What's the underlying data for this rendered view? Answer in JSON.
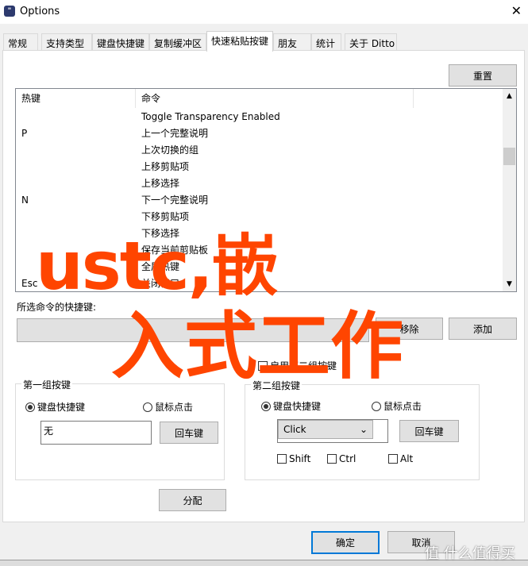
{
  "window": {
    "title": "Options",
    "icon": "ditto-app-icon",
    "close": "✕"
  },
  "tabs": [
    "常规",
    "支持类型",
    "键盘快捷键",
    "复制缓冲区",
    "快速粘贴按键",
    "朋友",
    "统计",
    "关于 Ditto"
  ],
  "reset_label": "重置",
  "list": {
    "headers": [
      "热键",
      "命令"
    ],
    "rows": [
      {
        "key": "",
        "cmd": "Toggle Transparency Enabled"
      },
      {
        "key": "P",
        "cmd": "上一个完整说明"
      },
      {
        "key": "",
        "cmd": "上次切换的组"
      },
      {
        "key": "",
        "cmd": "上移剪贴项"
      },
      {
        "key": "",
        "cmd": "上移选择"
      },
      {
        "key": "N",
        "cmd": "下一个完整说明"
      },
      {
        "key": "",
        "cmd": "下移剪贴项"
      },
      {
        "key": "",
        "cmd": "下移选择"
      },
      {
        "key": "",
        "cmd": "保存当前剪贴板"
      },
      {
        "key": "",
        "cmd": "全屏热键"
      },
      {
        "key": "Esc",
        "cmd": "关闭窗口"
      }
    ]
  },
  "selected_label": "所选命令的快捷键:",
  "remove_label": "移除",
  "add_label": "添加",
  "enable_second": "启用第二组按键",
  "group1": {
    "title": "第一组按键",
    "radio_keyboard": "键盘快捷键",
    "radio_mouse": "鼠标点击",
    "value": "无",
    "enter": "回车键"
  },
  "group2": {
    "title": "第二组按键",
    "radio_keyboard": "键盘快捷键",
    "radio_mouse": "鼠标点击",
    "select": "Click",
    "enter": "回车键",
    "shift": "Shift",
    "ctrl": "Ctrl",
    "alt": "Alt"
  },
  "assign_label": "分配",
  "ok_label": "确定",
  "cancel_label": "取消",
  "watermark": {
    "line1": "ustc,嵌",
    "line2": "入式工作",
    "corner": "值 什么值得买",
    "color": "#ff4500"
  }
}
